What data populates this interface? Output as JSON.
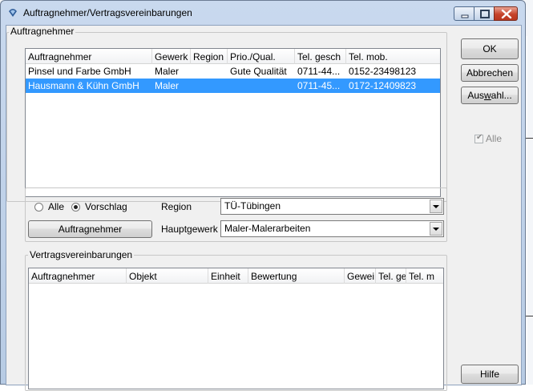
{
  "window": {
    "title": "Auftragnehmer/Vertragsvereinbarungen"
  },
  "contractors_group": {
    "title": "Auftragnehmer",
    "columns": [
      "Auftragnehmer",
      "Gewerk",
      "Region",
      "Prio./Qual.",
      "Tel. gesch",
      "Tel. mob."
    ],
    "rows": [
      {
        "name": "Pinsel und Farbe GmbH",
        "trade": "Maler",
        "region": "",
        "prio": "Gute Qualität",
        "tel_business": "0711-44...",
        "tel_mobile": "0152-23498123",
        "selected": false
      },
      {
        "name": "Hausmann & Kühn GmbH",
        "trade": "Maler",
        "region": "",
        "prio": "",
        "tel_business": "0711-45...",
        "tel_mobile": "0172-12409823",
        "selected": true
      }
    ]
  },
  "filter": {
    "radio_all_label": "Alle",
    "radio_suggestion_label": "Vorschlag",
    "selected": "Vorschlag",
    "region_label": "Region",
    "region_value": "TÜ-Tübingen",
    "main_trade_label": "Hauptgewerk",
    "main_trade_value": "Maler-Malerarbeiten",
    "contractor_button": "Auftragnehmer"
  },
  "agreements_group": {
    "title": "Vertragsvereinbarungen",
    "columns": [
      "Auftragnehmer",
      "Objekt",
      "Einheit",
      "Bewertung",
      "Gewei",
      "Tel. ge",
      "Tel. m"
    ],
    "rows": []
  },
  "buttons": {
    "ok": "OK",
    "cancel": "Abbrechen",
    "select_prefix": "Aus",
    "select_underlined": "w",
    "select_suffix": "ahl...",
    "all_checkbox_label": "Alle",
    "all_checkbox_checked": true,
    "help": "Hilfe"
  },
  "colors": {
    "selection": "#3399ff",
    "close_button": "#c6432b",
    "title_bar": "#c9d9ee"
  },
  "icons": {
    "app": "app-icon",
    "minimize": "minimize-icon",
    "maximize": "maximize-icon",
    "close": "close-icon",
    "dropdown": "chevron-down-icon",
    "check": "checkmark-icon"
  }
}
